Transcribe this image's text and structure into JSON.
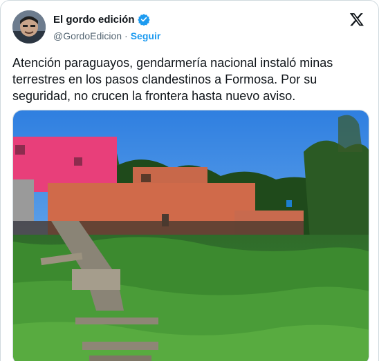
{
  "author": {
    "display_name": "El gordo edición",
    "handle": "@GordoEdicion",
    "separator": "·",
    "follow_label": "Seguir",
    "verified_color": "#1d9bf0"
  },
  "tweet": {
    "text": "Atención paraguayos, gendarmería nacional instaló minas\nterrestres en los pasos clandestinos a Formosa. Por su\nseguridad, no crucen la frontera hasta nuevo aviso."
  },
  "media": {
    "icon": "photo-icon"
  },
  "brand": {
    "logo": "x-logo-icon"
  }
}
